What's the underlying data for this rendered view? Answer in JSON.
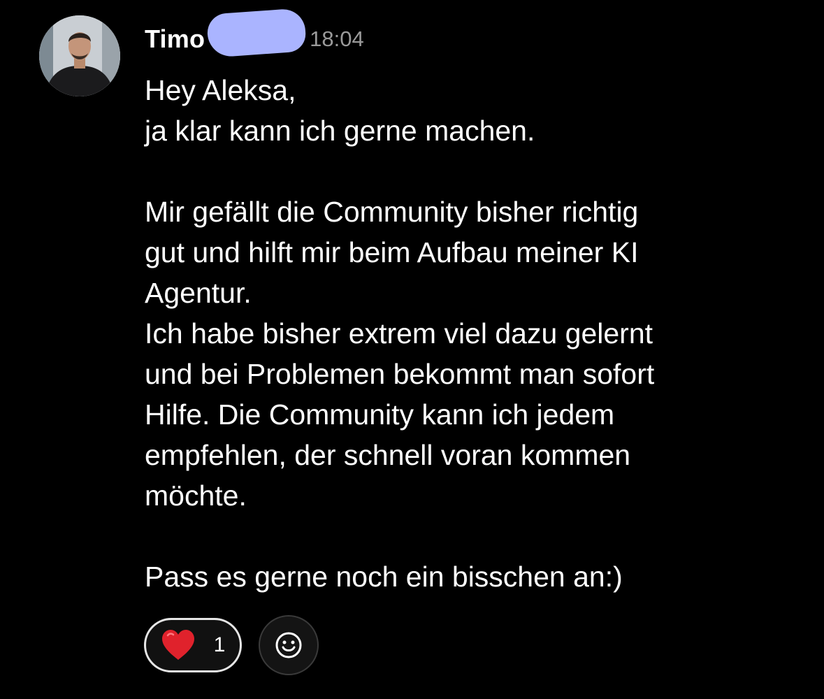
{
  "message": {
    "sender_name": "Timo",
    "timestamp": "18:04",
    "lines": [
      "Hey Aleksa,",
      "ja klar kann ich gerne machen.",
      "",
      "Mir gefällt die Community bisher richtig",
      "gut und hilft mir beim Aufbau meiner KI",
      "Agentur.",
      "Ich habe bisher extrem viel dazu gelernt",
      "und bei Problemen bekommt man sofort",
      "Hilfe. Die Community kann ich jedem",
      "empfehlen, der schnell voran kommen",
      "möchte.",
      "",
      "Pass es gerne noch ein bisschen an:)"
    ]
  },
  "reactions": {
    "items": [
      {
        "icon": "heart-icon",
        "count": "1"
      }
    ],
    "add_icon": "smiley-icon"
  },
  "colors": {
    "background": "#000000",
    "text": "#ffffff",
    "timestamp": "#9a9a9a",
    "redaction": "#aab4ff",
    "heart": "#e0222c"
  }
}
